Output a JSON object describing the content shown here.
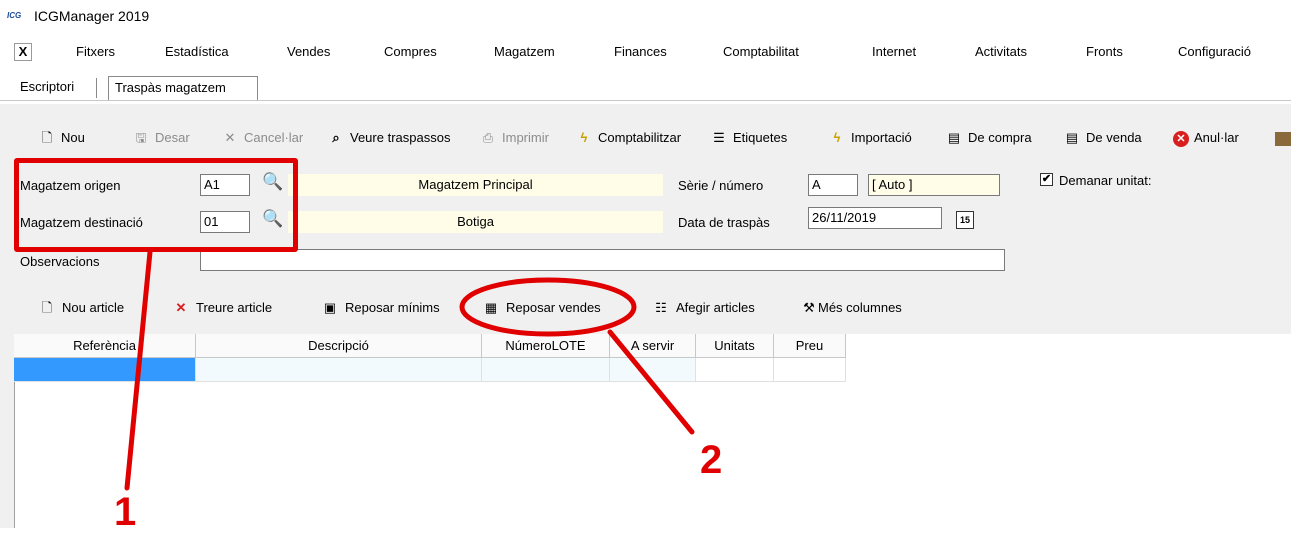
{
  "window": {
    "title": "ICGManager 2019",
    "logo_text": "ICG"
  },
  "menubar": {
    "close_symbol": "X",
    "items": [
      "Fitxers",
      "Estadística",
      "Vendes",
      "Compres",
      "Magatzem",
      "Finances",
      "Comptabilitat",
      "Internet",
      "Activitats",
      "Fronts",
      "Configuració"
    ]
  },
  "tabs": {
    "escriptori": "Escriptori",
    "traspas": "Traspàs magatzem"
  },
  "toolbar": {
    "nou": "Nou",
    "desar": "Desar",
    "cancelar": "Cancel·lar",
    "veure_traspassos": "Veure traspassos",
    "imprimir": "Imprimir",
    "comptabilitzar": "Comptabilitzar",
    "etiquetes": "Etiquetes",
    "importacio": "Importació",
    "de_compra": "De compra",
    "de_venda": "De venda",
    "anullar": "Anul·lar"
  },
  "form": {
    "origen_label": "Magatzem origen",
    "origen_code": "A1",
    "origen_name": "Magatzem Principal",
    "desti_label": "Magatzem destinació",
    "desti_code": "01",
    "desti_name": "Botiga",
    "serie_label": "Sèrie / número",
    "serie_value": "A",
    "numero_value": "[ Auto ]",
    "data_label": "Data de traspàs",
    "data_value": "26/11/2019",
    "calendar_label": "15",
    "demanar_label": "Demanar unitat:",
    "demanar_checked": true,
    "observacions_label": "Observacions",
    "observacions_value": ""
  },
  "articles_toolbar": {
    "nou_article": "Nou article",
    "treure_article": "Treure article",
    "reposar_minims": "Reposar mínims",
    "reposar_vendes": "Reposar vendes",
    "afegir_articles": "Afegir articles",
    "mes_columnes": "Més columnes"
  },
  "grid": {
    "columns": [
      "Referència",
      "Descripció",
      "NúmeroLOTE",
      "A servir",
      "Unitats",
      "Preu"
    ]
  },
  "annotations": {
    "label_1": "1",
    "label_2": "2",
    "color": "#e00000"
  }
}
